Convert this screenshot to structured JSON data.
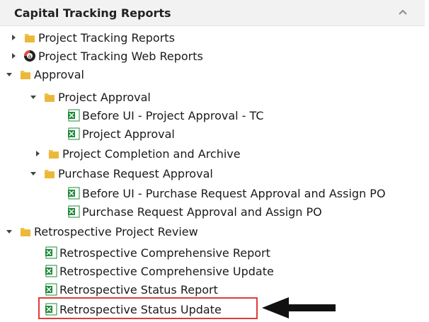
{
  "header": {
    "title": "Capital Tracking Reports"
  },
  "tree": [
    {
      "label": "Project Tracking Reports",
      "type": "folder",
      "state": "collapsed"
    },
    {
      "label": "Project Tracking Web Reports",
      "type": "web",
      "state": "collapsed"
    },
    {
      "label": "Approval",
      "type": "folder",
      "state": "expanded"
    },
    {
      "label": "Project Approval",
      "type": "folder",
      "state": "expanded"
    },
    {
      "label": "Before UI - Project Approval - TC",
      "type": "report"
    },
    {
      "label": "Project Approval",
      "type": "report"
    },
    {
      "label": "Project Completion and Archive",
      "type": "folder",
      "state": "collapsed"
    },
    {
      "label": "Purchase Request Approval",
      "type": "folder",
      "state": "expanded"
    },
    {
      "label": "Before UI - Purchase Request Approval and Assign PO",
      "type": "report"
    },
    {
      "label": "Purchase Request Approval and Assign PO",
      "type": "report"
    },
    {
      "label": "Retrospective Project Review",
      "type": "folder",
      "state": "expanded"
    },
    {
      "label": "Retrospective Comprehensive Report",
      "type": "report"
    },
    {
      "label": "Retrospective Comprehensive Update",
      "type": "report"
    },
    {
      "label": "Retrospective Status Report",
      "type": "report"
    },
    {
      "label": "Retrospective Status Update",
      "type": "report",
      "highlighted": true
    }
  ],
  "colors": {
    "highlight": "#e03b3b",
    "folder": "#f2c24a",
    "excel": "#1f8a3a"
  }
}
